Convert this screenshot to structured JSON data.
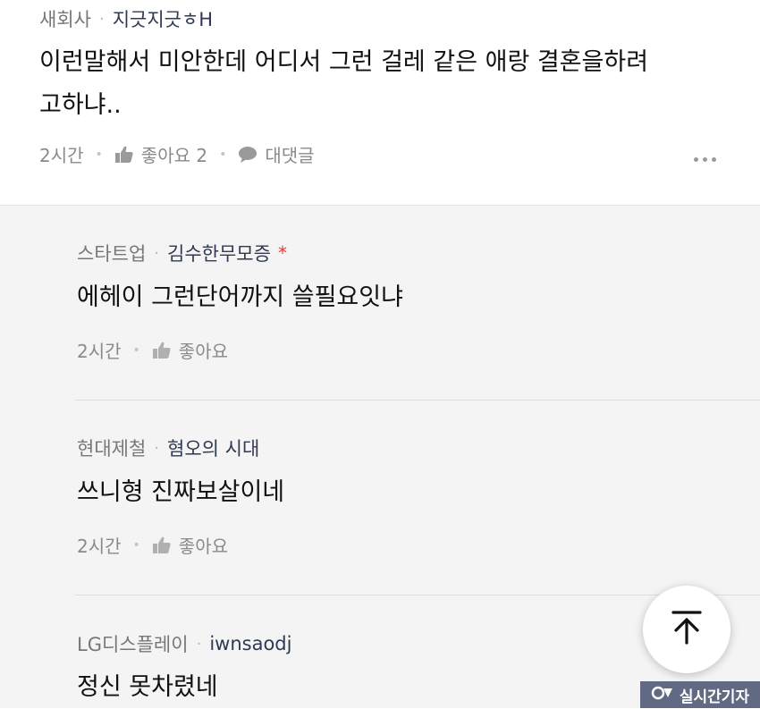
{
  "main_comment": {
    "company": "새회사",
    "nickname": "지긋지긋ㅎH",
    "text_line1": "이런말해서 미안한데 어디서 그런 걸레 같은 애랑 결혼을하려",
    "text_line2": "고하냐..",
    "time": "2시간",
    "like_label": "좋아요 2",
    "reply_label": "대댓글",
    "icons": [
      "thumbs-up-icon",
      "speech-bubble-icon",
      "more-icon"
    ]
  },
  "replies": [
    {
      "company": "스타트업",
      "nickname": "김수한무모증",
      "star": "*",
      "text": "에헤이 그런단어까지 쓸필요잇냐",
      "time": "2시간",
      "like_label": "좋아요"
    },
    {
      "company": "현대제철",
      "nickname": "혐오의 시대",
      "text": "쓰니형 진짜보살이네",
      "time": "2시간",
      "like_label": "좋아요"
    },
    {
      "company": "LG디스플레이",
      "nickname": "iwnsaodj",
      "text": "정신 못차렸네"
    }
  ],
  "fab": {
    "icon": "scroll-to-top-icon"
  },
  "watermark": {
    "text": "실시간기자"
  },
  "colors": {
    "nickname": "#2f3a52",
    "meta": "#777777",
    "reply_bg": "#f4f4f4",
    "star": "#e53935"
  }
}
